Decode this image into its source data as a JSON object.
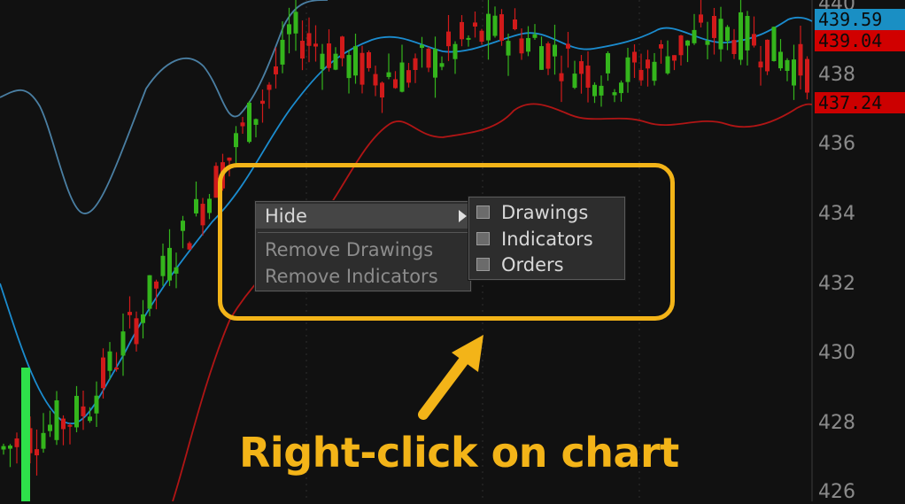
{
  "price_axis": {
    "labels": [
      "440",
      "438",
      "436",
      "434",
      "432",
      "430",
      "428",
      "426"
    ],
    "price_tags": [
      {
        "value": "439.59",
        "bg": "#1a8fc4",
        "fg": "#0b0b0b"
      },
      {
        "value": "439.04",
        "bg": "#d10000",
        "fg": "#0b0b0b"
      },
      {
        "value": "437.24",
        "bg": "#cc0000",
        "fg": "#0b0b0b"
      }
    ]
  },
  "context_menu": {
    "hide_label": "Hide",
    "remove_drawings_label": "Remove Drawings",
    "remove_indicators_label": "Remove Indicators"
  },
  "hide_submenu": {
    "items": [
      {
        "label": "Drawings",
        "checked": false
      },
      {
        "label": "Indicators",
        "checked": false
      },
      {
        "label": "Orders",
        "checked": false
      }
    ]
  },
  "annotation": {
    "caption": "Right-click on chart",
    "accent_color": "#f3b418"
  },
  "colors": {
    "bull_candle": "#34b51c",
    "bear_candle": "#d11a1a",
    "upper_band": "#4a7fa3",
    "middle_band": "#1b8ccf",
    "lower_band": "#b01515"
  }
}
